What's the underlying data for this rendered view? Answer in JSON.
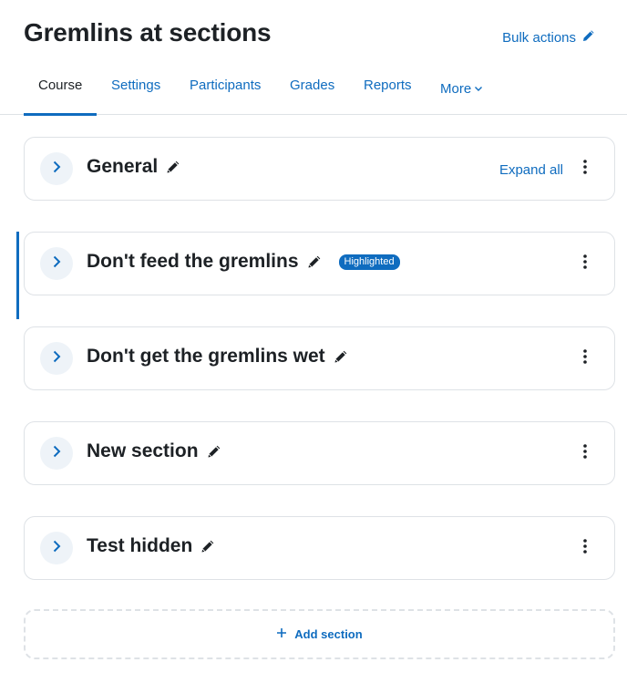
{
  "header": {
    "title": "Gremlins at sections",
    "bulk_actions_label": "Bulk actions"
  },
  "tabs": [
    {
      "label": "Course",
      "active": true
    },
    {
      "label": "Settings"
    },
    {
      "label": "Participants"
    },
    {
      "label": "Grades"
    },
    {
      "label": "Reports"
    },
    {
      "label": "More"
    }
  ],
  "sections": [
    {
      "title": "General",
      "action": "Expand all"
    },
    {
      "title": "Don't feed the gremlins",
      "badge": "Highlighted",
      "highlighted": true
    },
    {
      "title": "Don't get the gremlins wet"
    },
    {
      "title": "New section"
    },
    {
      "title": "Test hidden"
    }
  ],
  "add_section_label": "Add section",
  "colors": {
    "accent": "#0f6cbf",
    "text": "#1d2125",
    "border": "#dee2e6",
    "button_bg": "#eef3f8"
  },
  "icons": {
    "edit": "pencil-icon",
    "collapse": "chevron-right-icon",
    "menu": "kebab-menu-icon",
    "more": "chevron-down-icon",
    "add": "plus-icon"
  }
}
